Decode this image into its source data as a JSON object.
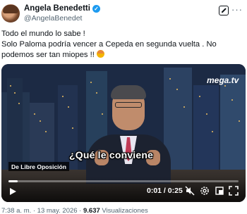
{
  "author": {
    "name": "Angela Benedetti",
    "handle": "@AngelaBenedet"
  },
  "tweet": {
    "line1": "Todo el mundo lo sabe !",
    "line2": "Solo Paloma podría vencer a Cepeda en segunda vuelta . No podemos ser tan miopes !!"
  },
  "video": {
    "brand": "mega.tv",
    "caption": "¿Qué le conviene",
    "lower_third": "De Libre Oposición",
    "time_display": "0:01 / 0:25",
    "progress": 0.04
  },
  "footer": {
    "timestamp": "7:38 a. m. · 13 may. 2026 ·",
    "views_count": "9.637",
    "views_label": "Visualizaciones"
  },
  "colors": {
    "accent": "#1d9bf0",
    "text": "#0f1419",
    "muted": "#536471"
  },
  "icons": [
    "verified-badge-icon",
    "grok-icon",
    "more-icon",
    "play-icon",
    "mute-icon",
    "settings-icon",
    "fullscreen-icon",
    "expand-icon"
  ]
}
